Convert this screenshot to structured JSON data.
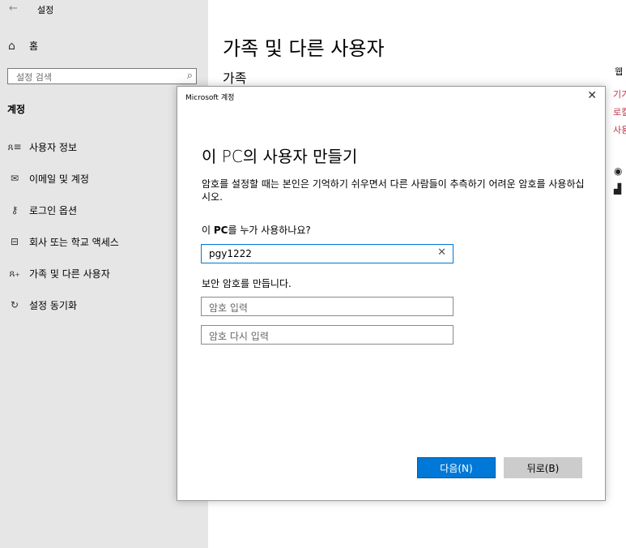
{
  "topbar": {
    "back_icon": "←",
    "app_title": "설정"
  },
  "sidebar": {
    "home_label": "홈",
    "search_placeholder": "설정 검색",
    "section_title": "계정",
    "items": [
      {
        "icon": "person-list-icon",
        "glyph": "ጸ≡",
        "label": "사용자 정보"
      },
      {
        "icon": "mail-icon",
        "glyph": "✉",
        "label": "이메일 및 계정"
      },
      {
        "icon": "key-icon",
        "glyph": "⚷",
        "label": "로그인 옵션"
      },
      {
        "icon": "briefcase-icon",
        "glyph": "⊟",
        "label": "회사 또는 학교 액세스"
      },
      {
        "icon": "add-person-icon",
        "glyph": "ጸ₊",
        "label": "가족 및 다른 사용자"
      },
      {
        "icon": "sync-icon",
        "glyph": "↻",
        "label": "설정 동기화"
      }
    ]
  },
  "main": {
    "title": "가족 및 다른 사용자",
    "subtitle": "가족",
    "right_col": {
      "web": "웹",
      "links": [
        "기기",
        "로컬",
        "사용"
      ]
    }
  },
  "dialog": {
    "window_title": "Microsoft 계정",
    "close_glyph": "✕",
    "heading": "이 PC의 사용자 만들기",
    "description": "암호를 설정할 때는 본인은 기억하기 쉬우면서 다른 사람들이 추측하기 어려운 암호를 사용하십시오.",
    "question_prefix": "이 ",
    "question_bold": "PC",
    "question_suffix": "를 누가 사용하나요?",
    "username_value": "pgy1222",
    "password_prompt": "보안 암호를 만듭니다.",
    "password_placeholder": "암호 입력",
    "password_confirm_placeholder": "암호 다시 입력",
    "next_label": "다음(N)",
    "back_label": "뒤로(B)"
  },
  "colors": {
    "accent": "#0078d7",
    "link": "#c0304a",
    "sidebar_bg": "#e6e6e6"
  }
}
